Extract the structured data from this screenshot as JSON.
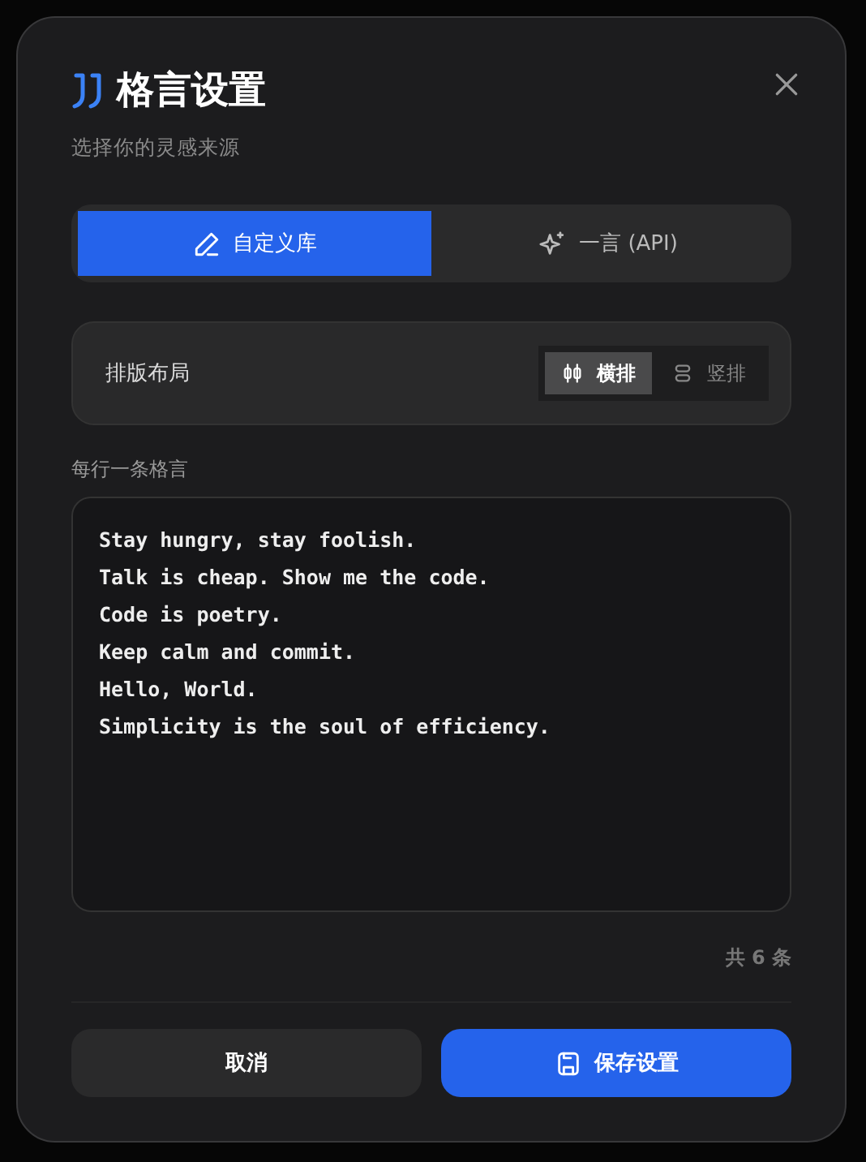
{
  "dialog": {
    "title": "格言设置",
    "subtitle": "选择你的灵感来源"
  },
  "source_tabs": [
    {
      "kind": "custom",
      "label": "自定义库",
      "selected": true
    },
    {
      "kind": "api",
      "label": "一言 (API)",
      "selected": false
    }
  ],
  "layout": {
    "label": "排版布局",
    "options": [
      {
        "kind": "horizontal",
        "label": "横排",
        "selected": true
      },
      {
        "kind": "vertical",
        "label": "竖排",
        "selected": false
      }
    ]
  },
  "quotes": {
    "label": "每行一条格言",
    "lines": [
      "Stay hungry, stay foolish.",
      "Talk is cheap. Show me the code.",
      "Code is poetry.",
      "Keep calm and commit.",
      "Hello, World.",
      "Simplicity is the soul of efficiency."
    ],
    "count": "共 6 条"
  },
  "buttons": [
    {
      "kind": "cancel",
      "label": "取消"
    },
    {
      "kind": "save",
      "label": "保存设置"
    }
  ]
}
